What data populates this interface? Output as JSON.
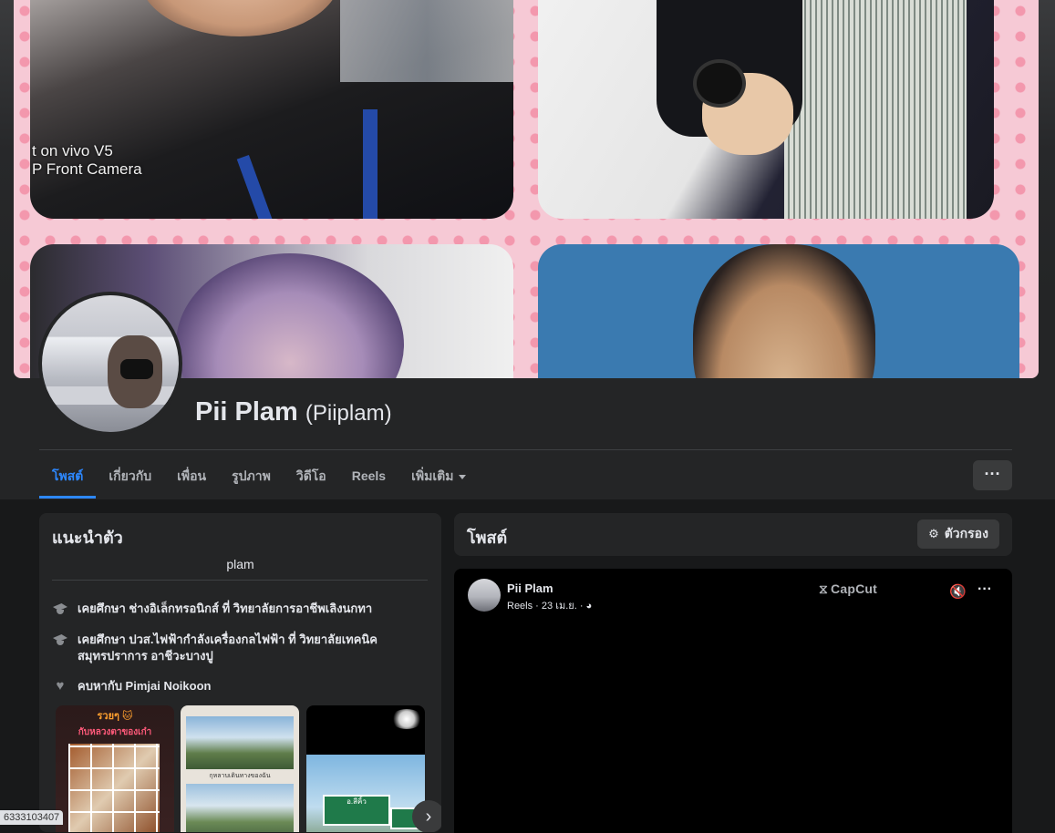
{
  "cover": {
    "photo_caption": "t on vivo V5\nP Front Camera"
  },
  "profile": {
    "name": "Pii Plam",
    "alternate_name": "(Piiplam)"
  },
  "tabs": [
    {
      "label": "โพสต์",
      "active": true
    },
    {
      "label": "เกี่ยวกับ",
      "active": false
    },
    {
      "label": "เพื่อน",
      "active": false
    },
    {
      "label": "รูปภาพ",
      "active": false
    },
    {
      "label": "วิดีโอ",
      "active": false
    },
    {
      "label": "Reels",
      "active": false
    },
    {
      "label": "เพิ่มเติม",
      "active": false
    }
  ],
  "more_button": "···",
  "intro": {
    "title": "แนะนำตัว",
    "bio": "plam",
    "items": [
      {
        "icon": "graduation-cap-icon",
        "text": "เคยศึกษา ช่างอิเล็กทรอนิกส์ ที่ วิทยาลัยการอาชีพเลิงนกทา"
      },
      {
        "icon": "graduation-cap-icon",
        "text": "เคยศึกษา ปวส.ไฟฟ้ากำลังเครื่องกลไฟฟ้า ที่ วิทยาลัยเทคนิคสมุทรปราการ อาชีวะบางปู"
      },
      {
        "icon": "heart-icon",
        "text": "คบหากับ Pimjai Noikoon"
      }
    ],
    "featured": {
      "item1_line1": "รวยๆ 🐱",
      "item1_line2": "กับหลวงตาของเก๋า",
      "item2_caption": "กุหลาบเดินทางของฉัน",
      "item3_sign": "อ.สีคิ้ว"
    },
    "next_glyph": "›"
  },
  "posts": {
    "title": "โพสต์",
    "filter_label": "ตัวกรอง",
    "post": {
      "author": "Pii Plam",
      "meta": "Reels · 23 เม.ย. · ◕",
      "watermark": "CapCut"
    }
  },
  "status_bar": "6333103407",
  "colors": {
    "accent": "#2d88ff",
    "background": "#18191a",
    "card": "#242526"
  }
}
